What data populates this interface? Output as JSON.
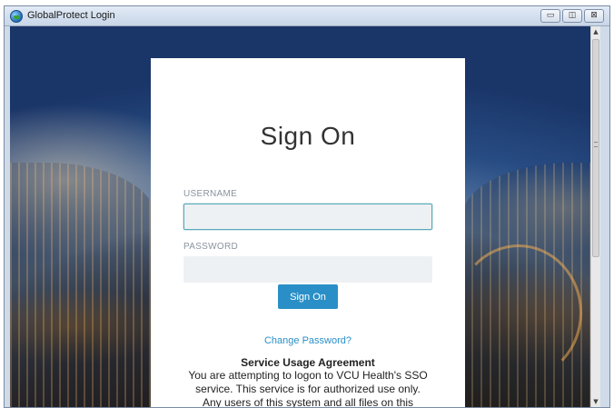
{
  "window": {
    "title": "GlobalProtect Login",
    "controls": {
      "minimize": "▭",
      "restore": "◫",
      "close": "⊠"
    }
  },
  "scrollbar": {
    "up": "▲",
    "down": "▼"
  },
  "login": {
    "heading": "Sign On",
    "username_label": "USERNAME",
    "username_value": "",
    "password_label": "PASSWORD",
    "password_value": "",
    "signon_button": "Sign On",
    "change_password_link": "Change Password?",
    "agreement_title": "Service Usage Agreement",
    "agreement_text": "You are attempting to logon to VCU Health's SSO service. This service is for authorized use only. Any users of this system and all files on this system may"
  },
  "colors": {
    "accent": "#2a8fc7",
    "field_bg": "#eef1f3",
    "focus_border": "#5aa9b8",
    "label": "#8a949e"
  },
  "icons": [
    "globalprotect-app-icon",
    "minimize-icon",
    "restore-icon",
    "close-icon"
  ]
}
